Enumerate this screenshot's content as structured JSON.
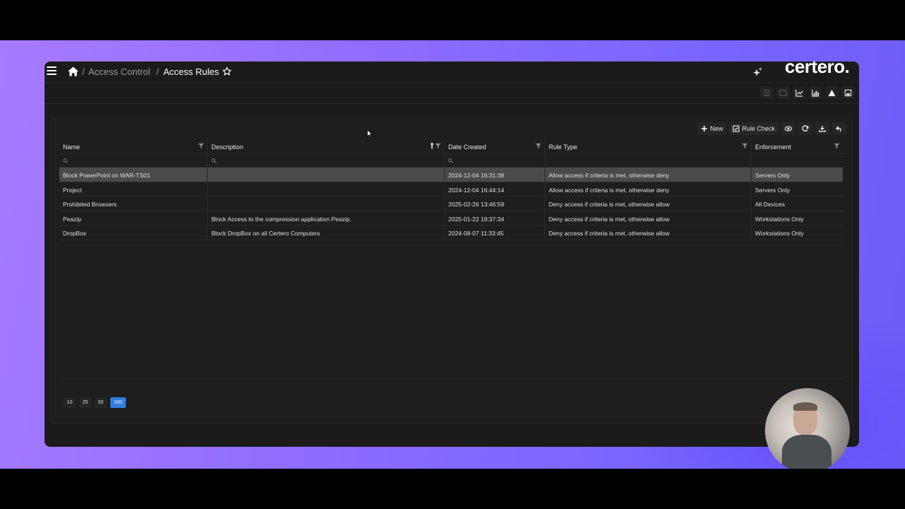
{
  "breadcrumb": {
    "parent": "Access Control",
    "separator": "/",
    "current": "Access Rules"
  },
  "brand": {
    "name": "certero."
  },
  "toolbar": {
    "new_label": "New",
    "rule_check_label": "Rule Check"
  },
  "table": {
    "columns": [
      "Name",
      "Description",
      "Date Created",
      "Rule Type",
      "Enforcement"
    ],
    "rows": [
      [
        "Block PowerPoint on WAR-TS01",
        "",
        "2024-12-04 16:31:38",
        "Allow access if criteria is met, otherwise deny",
        "Servers Only"
      ],
      [
        "Project",
        "",
        "2024-12-04 16:44:14",
        "Allow access if criteria is met, otherwise deny",
        "Servers Only"
      ],
      [
        "Prohibited Browsers",
        "",
        "2025-02-26 13:46:59",
        "Deny access if criteria is met, otherwise allow",
        "All Devices"
      ],
      [
        "Peazip",
        "Block Access to the compression application Peazip.",
        "2025-01-22 19:37:34",
        "Deny access if criteria is met, otherwise allow",
        "Workstations Only"
      ],
      [
        "DropBox",
        "Block DropBox on all Certero Computers",
        "2024-08-07 11:33:45",
        "Deny access if criteria is met, otherwise allow",
        "Workstations Only"
      ]
    ],
    "selected_row": 0,
    "sorted_column": "Description"
  },
  "pager": {
    "sizes": [
      "10",
      "25",
      "50",
      "100"
    ],
    "active": "100"
  },
  "colors": {
    "accent": "#2f7fe0",
    "background": "#1b1b1b",
    "selected_row": "#4a4a4a"
  }
}
